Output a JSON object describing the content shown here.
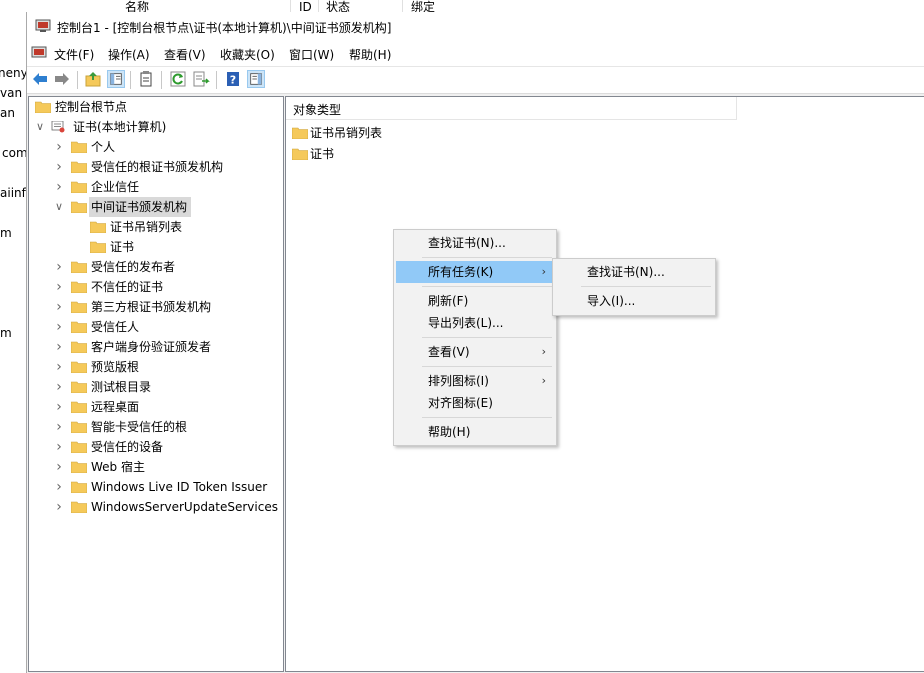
{
  "background": {
    "header_cols": [
      "名称",
      "ID",
      "状态",
      "绑定"
    ],
    "left_fragments": [
      "nenya",
      "van",
      "an",
      "com",
      "aiinfo",
      "m",
      "m"
    ]
  },
  "window": {
    "title": "控制台1 - [控制台根节点\\证书(本地计算机)\\中间证书颁发机构]"
  },
  "menubar": {
    "items": [
      "文件(F)",
      "操作(A)",
      "查看(V)",
      "收藏夹(O)",
      "窗口(W)",
      "帮助(H)"
    ]
  },
  "toolbar": {
    "buttons": [
      "back-icon",
      "forward-icon",
      "up-folder-icon",
      "show-hide-tree-icon",
      "properties-icon",
      "refresh-icon",
      "export-list-icon",
      "help-icon",
      "show-hide-action-pane-icon"
    ]
  },
  "tree": {
    "root": "控制台根节点",
    "store": "证书(本地计算机)",
    "items": [
      "个人",
      "受信任的根证书颁发机构",
      "企业信任",
      "中间证书颁发机构",
      "证书吊销列表",
      "证书",
      "受信任的发布者",
      "不信任的证书",
      "第三方根证书颁发机构",
      "受信任人",
      "客户端身份验证颁发者",
      "预览版根",
      "测试根目录",
      "远程桌面",
      "智能卡受信任的根",
      "受信任的设备",
      "Web 宿主",
      "Windows Live ID Token Issuer",
      "WindowsServerUpdateServices"
    ]
  },
  "list": {
    "column_header": "对象类型",
    "items": [
      "证书吊销列表",
      "证书"
    ]
  },
  "context_menu": {
    "items": [
      "查找证书(N)...",
      "所有任务(K)",
      "刷新(F)",
      "导出列表(L)...",
      "查看(V)",
      "排列图标(I)",
      "对齐图标(E)",
      "帮助(H)"
    ],
    "highlighted": "所有任务(K)"
  },
  "submenu": {
    "items": [
      "查找证书(N)...",
      "导入(I)..."
    ]
  },
  "colors": {
    "folder": "#f5c95a",
    "highlight": "#91c9f7",
    "selection": "#d9d9d9"
  }
}
